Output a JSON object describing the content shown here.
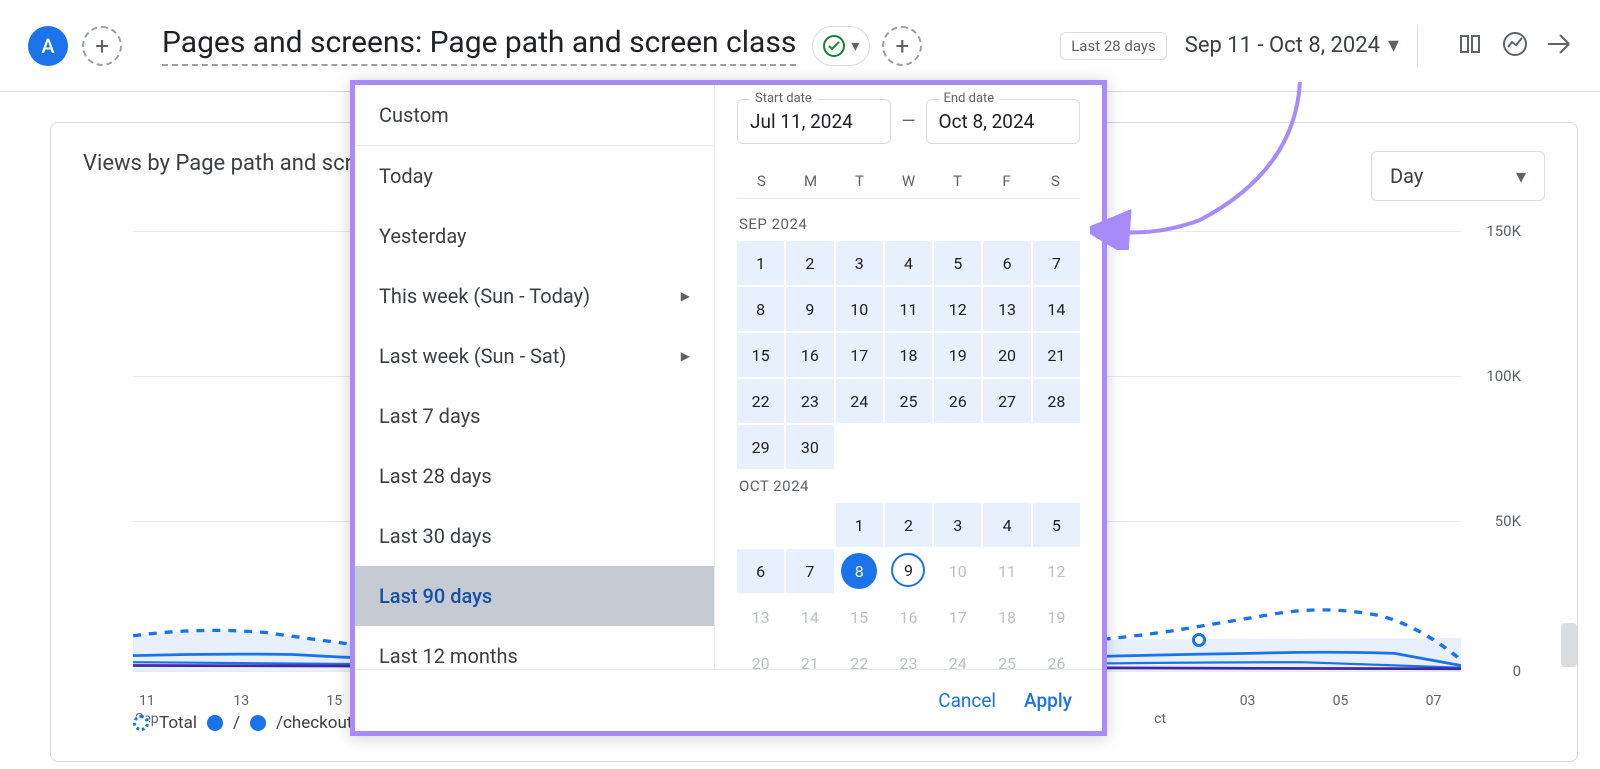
{
  "header": {
    "avatar_letter": "A",
    "title": "Pages and screens: Page path and screen class",
    "date_chip": "Last 28 days",
    "date_range": "Sep 11 - Oct 8, 2024"
  },
  "card": {
    "title": "Views by Page path and screen class over time",
    "granularity": "Day",
    "y_labels": [
      "150K",
      "100K",
      "50K",
      "0"
    ],
    "x_labels": [
      "11",
      "13",
      "15",
      "03",
      "05",
      "07"
    ],
    "x_sublabel_left": "Sep",
    "x_sublabel_right": "ct"
  },
  "legend": {
    "total": "Total",
    "s1": "/",
    "s2": "/checkout",
    "s3": "/"
  },
  "popup": {
    "presets": [
      {
        "label": "Custom",
        "arrow": false
      },
      {
        "label": "Today",
        "arrow": false
      },
      {
        "label": "Yesterday",
        "arrow": false
      },
      {
        "label": "This week (Sun - Today)",
        "arrow": true
      },
      {
        "label": "Last week (Sun - Sat)",
        "arrow": true
      },
      {
        "label": "Last 7 days",
        "arrow": false
      },
      {
        "label": "Last 28 days",
        "arrow": false
      },
      {
        "label": "Last 30 days",
        "arrow": false
      },
      {
        "label": "Last 90 days",
        "arrow": false,
        "selected": true
      },
      {
        "label": "Last 12 months",
        "arrow": false
      }
    ],
    "start_label": "Start date",
    "end_label": "End date",
    "start_val": "Jul 11, 2024",
    "end_val": "Oct 8, 2024",
    "dow": [
      "S",
      "M",
      "T",
      "W",
      "T",
      "F",
      "S"
    ],
    "months": [
      {
        "label": "SEP 2024",
        "offset": 0,
        "days": 30,
        "range": {
          "from": 1,
          "to": 30
        }
      },
      {
        "label": "OCT 2024",
        "offset": 2,
        "days": 31,
        "range": {
          "from": 1,
          "to": 8
        },
        "end": 8,
        "today": 9,
        "disabled_from": 10
      }
    ],
    "cancel": "Cancel",
    "apply": "Apply"
  },
  "chart_data": {
    "type": "line",
    "xlabel": "",
    "ylabel": "",
    "ylim": [
      0,
      150000
    ],
    "x": [
      "Sep 11",
      "Sep 12",
      "Sep 13",
      "Sep 14",
      "Sep 15",
      "Sep 16",
      "Oct 1",
      "Oct 2",
      "Oct 3",
      "Oct 4",
      "Oct 5",
      "Oct 6",
      "Oct 7",
      "Oct 8"
    ],
    "series": [
      {
        "name": "Total",
        "style": "dashed",
        "values": [
          12000,
          13000,
          11000,
          9000,
          10000,
          11500,
          10500,
          11000,
          14000,
          12000,
          13500,
          16000,
          15000,
          4000
        ]
      },
      {
        "name": "/",
        "style": "solid",
        "values": [
          5000,
          5200,
          5000,
          4200,
          4500,
          5000,
          4600,
          4800,
          5200,
          4700,
          5000,
          5400,
          5200,
          1800
        ]
      },
      {
        "name": "/checkout",
        "style": "solid",
        "values": [
          2200,
          2300,
          2200,
          1900,
          2000,
          2200,
          2000,
          2100,
          2300,
          2100,
          2200,
          2400,
          2300,
          800
        ]
      },
      {
        "name": "/",
        "style": "solid-purple",
        "values": [
          1400,
          1500,
          1400,
          1200,
          1300,
          1450,
          1300,
          1350,
          1500,
          1350,
          1450,
          1600,
          1500,
          500
        ]
      }
    ]
  }
}
